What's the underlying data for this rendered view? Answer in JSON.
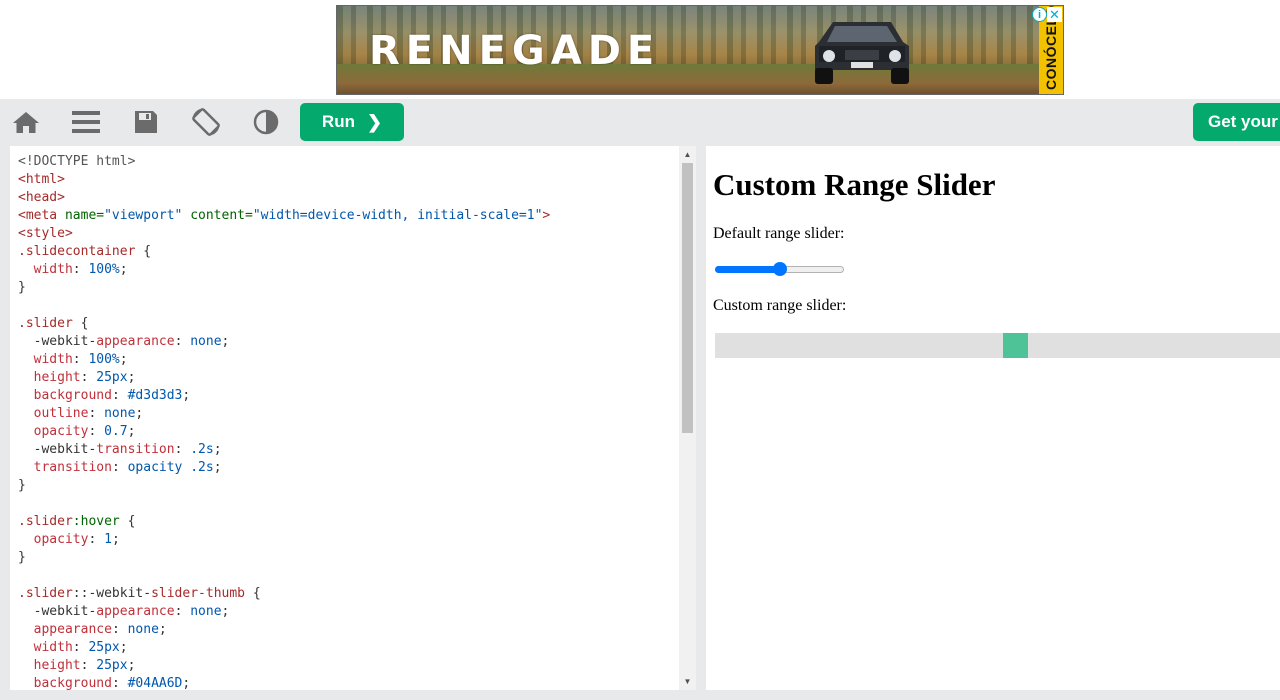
{
  "ad": {
    "brand_text": "RENEGADE",
    "cta_text": "CONÓCELO",
    "info_icon": "i",
    "close_icon": "✕",
    "colors": {
      "cta_bg": "#f2c200",
      "info": "#00aecd"
    }
  },
  "toolbar": {
    "icons": [
      "home-icon",
      "menu-icon",
      "save-icon",
      "rotate-icon",
      "contrast-icon"
    ],
    "run_label": "Run",
    "run_chevron": "❯",
    "get_label": "Get your own website",
    "accent": "#04aa6d"
  },
  "editor": {
    "lines": [
      [
        [
          "c-doc",
          "<!DOCTYPE html>"
        ]
      ],
      [
        [
          "c-tag",
          "<html>"
        ]
      ],
      [
        [
          "c-tag",
          "<head>"
        ]
      ],
      [
        [
          "c-tag",
          "<meta "
        ],
        [
          "c-attr",
          "name="
        ],
        [
          "c-val",
          "\"viewport\" "
        ],
        [
          "c-attr",
          "content="
        ],
        [
          "c-val",
          "\"width=device-width, initial-scale=1\""
        ],
        [
          "c-tag",
          ">"
        ]
      ],
      [
        [
          "c-tag",
          "<style>"
        ]
      ],
      [
        [
          "c-sel",
          ".slidecontainer "
        ],
        [
          "c-dim",
          "{"
        ]
      ],
      [
        [
          "c-dim",
          "  "
        ],
        [
          "c-prop",
          "width"
        ],
        [
          "c-dim",
          ": "
        ],
        [
          "c-num",
          "100%"
        ],
        [
          "c-dim",
          ";"
        ]
      ],
      [
        [
          "c-dim",
          "}"
        ]
      ],
      [
        [
          "c-dim",
          ""
        ]
      ],
      [
        [
          "c-sel",
          ".slider "
        ],
        [
          "c-dim",
          "{"
        ]
      ],
      [
        [
          "c-dim",
          "  -webkit-"
        ],
        [
          "c-prop",
          "appearance"
        ],
        [
          "c-dim",
          ": "
        ],
        [
          "c-num",
          "none"
        ],
        [
          "c-dim",
          ";"
        ]
      ],
      [
        [
          "c-dim",
          "  "
        ],
        [
          "c-prop",
          "width"
        ],
        [
          "c-dim",
          ": "
        ],
        [
          "c-num",
          "100%"
        ],
        [
          "c-dim",
          ";"
        ]
      ],
      [
        [
          "c-dim",
          "  "
        ],
        [
          "c-prop",
          "height"
        ],
        [
          "c-dim",
          ": "
        ],
        [
          "c-num",
          "25px"
        ],
        [
          "c-dim",
          ";"
        ]
      ],
      [
        [
          "c-dim",
          "  "
        ],
        [
          "c-prop",
          "background"
        ],
        [
          "c-dim",
          ": "
        ],
        [
          "c-num",
          "#d3d3d3"
        ],
        [
          "c-dim",
          ";"
        ]
      ],
      [
        [
          "c-dim",
          "  "
        ],
        [
          "c-prop",
          "outline"
        ],
        [
          "c-dim",
          ": "
        ],
        [
          "c-num",
          "none"
        ],
        [
          "c-dim",
          ";"
        ]
      ],
      [
        [
          "c-dim",
          "  "
        ],
        [
          "c-prop",
          "opacity"
        ],
        [
          "c-dim",
          ": "
        ],
        [
          "c-num",
          "0.7"
        ],
        [
          "c-dim",
          ";"
        ]
      ],
      [
        [
          "c-dim",
          "  -webkit-"
        ],
        [
          "c-prop",
          "transition"
        ],
        [
          "c-dim",
          ": "
        ],
        [
          "c-num",
          ".2s"
        ],
        [
          "c-dim",
          ";"
        ]
      ],
      [
        [
          "c-dim",
          "  "
        ],
        [
          "c-prop",
          "transition"
        ],
        [
          "c-dim",
          ": "
        ],
        [
          "c-num",
          "opacity .2s"
        ],
        [
          "c-dim",
          ";"
        ]
      ],
      [
        [
          "c-dim",
          "}"
        ]
      ],
      [
        [
          "c-dim",
          ""
        ]
      ],
      [
        [
          "c-sel",
          ".slider"
        ],
        [
          "c-pseudo",
          ":hover "
        ],
        [
          "c-dim",
          "{"
        ]
      ],
      [
        [
          "c-dim",
          "  "
        ],
        [
          "c-prop",
          "opacity"
        ],
        [
          "c-dim",
          ": "
        ],
        [
          "c-num",
          "1"
        ],
        [
          "c-dim",
          ";"
        ]
      ],
      [
        [
          "c-dim",
          "}"
        ]
      ],
      [
        [
          "c-dim",
          ""
        ]
      ],
      [
        [
          "c-sel",
          ".slider"
        ],
        [
          "c-dim",
          "::-webkit-"
        ],
        [
          "c-sel",
          "slider-thumb "
        ],
        [
          "c-dim",
          "{"
        ]
      ],
      [
        [
          "c-dim",
          "  -webkit-"
        ],
        [
          "c-prop",
          "appearance"
        ],
        [
          "c-dim",
          ": "
        ],
        [
          "c-num",
          "none"
        ],
        [
          "c-dim",
          ";"
        ]
      ],
      [
        [
          "c-dim",
          "  "
        ],
        [
          "c-prop",
          "appearance"
        ],
        [
          "c-dim",
          ": "
        ],
        [
          "c-num",
          "none"
        ],
        [
          "c-dim",
          ";"
        ]
      ],
      [
        [
          "c-dim",
          "  "
        ],
        [
          "c-prop",
          "width"
        ],
        [
          "c-dim",
          ": "
        ],
        [
          "c-num",
          "25px"
        ],
        [
          "c-dim",
          ";"
        ]
      ],
      [
        [
          "c-dim",
          "  "
        ],
        [
          "c-prop",
          "height"
        ],
        [
          "c-dim",
          ": "
        ],
        [
          "c-num",
          "25px"
        ],
        [
          "c-dim",
          ";"
        ]
      ],
      [
        [
          "c-dim",
          "  "
        ],
        [
          "c-prop",
          "background"
        ],
        [
          "c-dim",
          ": "
        ],
        [
          "c-num",
          "#04AA6D"
        ],
        [
          "c-dim",
          ";"
        ]
      ]
    ],
    "scroll_up": "▲",
    "scroll_down": "▼"
  },
  "preview": {
    "title": "Custom Range Slider",
    "default_label": "Default range slider:",
    "custom_label": "Custom range slider:",
    "default_slider_value": 0.5,
    "custom_slider_value": 0.5,
    "colors": {
      "default_accent": "#0075ff",
      "custom_track": "#d3d3d3",
      "custom_thumb": "#04aa6d"
    }
  }
}
